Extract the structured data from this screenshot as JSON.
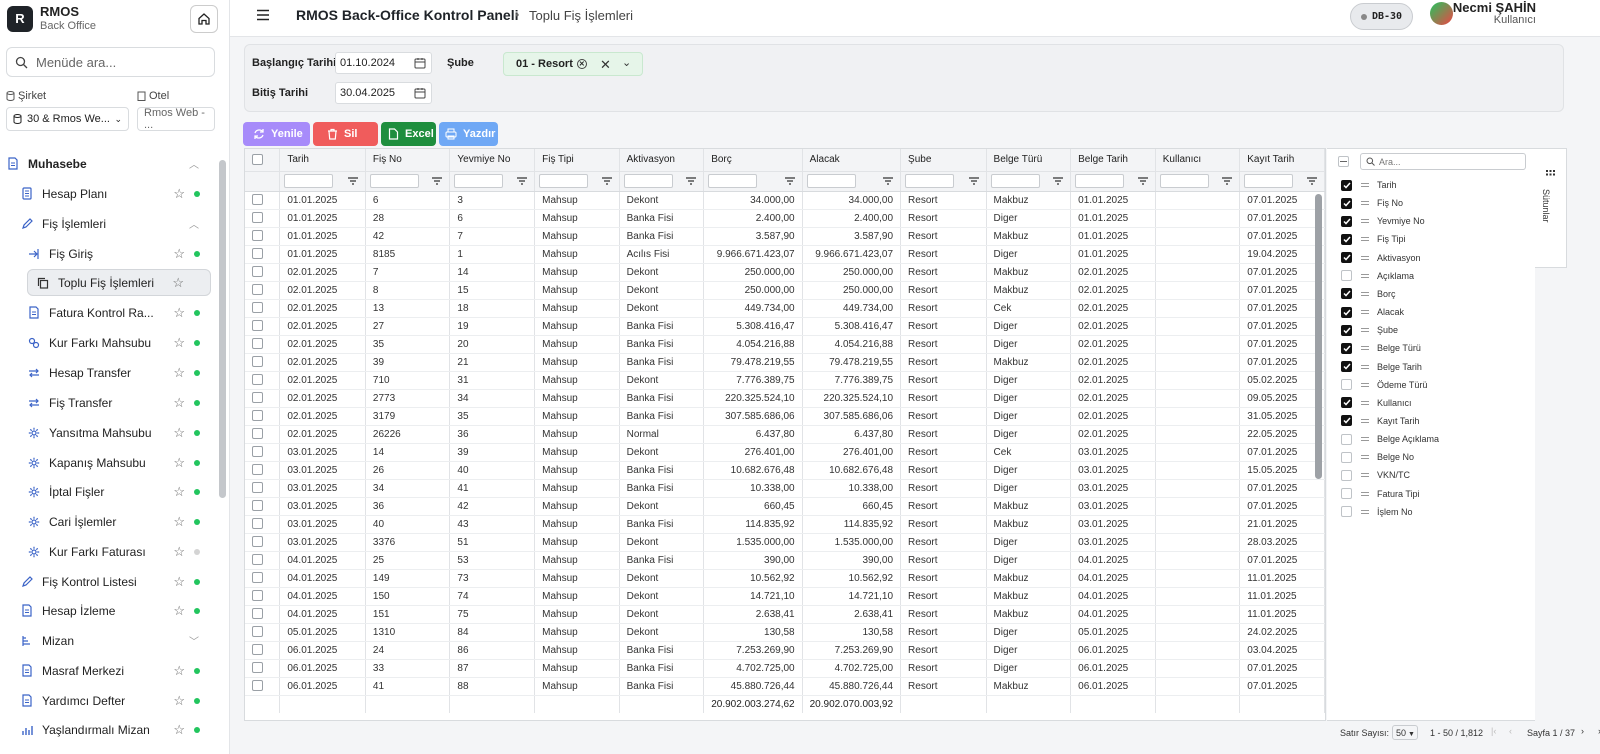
{
  "brand": {
    "name": "RMOS",
    "subtitle": "Back Office",
    "logo_letter": "R"
  },
  "menu_search": {
    "placeholder": "Menüde ara..."
  },
  "company": {
    "label": "Şirket",
    "value": "30 & Rmos We..."
  },
  "hotel": {
    "label": "Otel",
    "value": "Rmos Web - ..."
  },
  "nav": [
    {
      "label": "Muhasebe",
      "icon": "document-icon",
      "trail": "chevron-up"
    },
    {
      "label": "Hesap Planı",
      "icon": "ledger-icon",
      "trail": "star-dot"
    },
    {
      "label": "Fiş İşlemleri",
      "icon": "pencil-icon",
      "trail": "chevron-up"
    },
    {
      "label": "Fiş Giriş",
      "icon": "entry-icon",
      "trail": "star-dot"
    },
    {
      "label": "Toplu Fiş İşlemleri",
      "icon": "copy-icon",
      "trail": "star",
      "active": true
    },
    {
      "label": "Fatura Kontrol Ra...",
      "icon": "document-icon",
      "trail": "star-dot"
    },
    {
      "label": "Kur Farkı Mahsubu",
      "icon": "link-icon",
      "trail": "star-dot"
    },
    {
      "label": "Hesap Transfer",
      "icon": "transfer-icon",
      "trail": "star-dot"
    },
    {
      "label": "Fiş Transfer",
      "icon": "transfer-icon",
      "trail": "star-dot"
    },
    {
      "label": "Yansıtma Mahsubu",
      "icon": "gear-icon",
      "trail": "star-dot"
    },
    {
      "label": "Kapanış Mahsubu",
      "icon": "gear-icon",
      "trail": "star-dot"
    },
    {
      "label": "İptal Fişler",
      "icon": "gear-icon",
      "trail": "star-dot"
    },
    {
      "label": "Cari İşlemler",
      "icon": "gear-icon",
      "trail": "star-dot"
    },
    {
      "label": "Kur Farkı Faturası",
      "icon": "gear-icon",
      "trail": "star-dot-gray"
    },
    {
      "label": "Fiş Kontrol Listesi",
      "icon": "pencil-icon",
      "trail": "star-dot"
    },
    {
      "label": "Hesap İzleme",
      "icon": "document-icon",
      "trail": "star-dot"
    },
    {
      "label": "Mizan",
      "icon": "tree-icon",
      "trail": "chevron-down"
    },
    {
      "label": "Masraf Merkezi",
      "icon": "document-icon",
      "trail": "star-dot"
    },
    {
      "label": "Yardımcı Defter",
      "icon": "document-icon",
      "trail": "star-dot"
    },
    {
      "label": "Yaşlandırmalı Mizan",
      "icon": "bar-chart-icon",
      "trail": "star-dot"
    }
  ],
  "header": {
    "title": "RMOS Back-Office Kontrol Paneli",
    "breadcrumb": "Toplu Fiş İşlemleri",
    "db": "DB-30",
    "user_name": "Necmi ŞAHİN",
    "user_role": "Kullanıcı"
  },
  "filters": {
    "start_label": "Başlangıç Tarihi",
    "start_value": "01.10.2024",
    "end_label": "Bitiş Tarihi",
    "end_value": "30.04.2025",
    "branch_label": "Şube",
    "branch_chip": "01 - Resort"
  },
  "toolbar": {
    "refresh": "Yenile",
    "delete": "Sil",
    "excel": "Excel",
    "print": "Yazdır"
  },
  "colors": {
    "refresh": "#a78bfa",
    "delete": "#f05c5c",
    "excel": "#1e8e3e",
    "print": "#6fa8f5"
  },
  "grid": {
    "columns": [
      "Tarih",
      "Fiş No",
      "Yevmiye No",
      "Fiş Tipi",
      "Aktivasyon",
      "Borç",
      "Alacak",
      "Şube",
      "Belge Türü",
      "Belge Tarih",
      "Kullanıcı",
      "Kayıt Tarih"
    ],
    "rows": [
      [
        "01.01.2025",
        "6",
        "3",
        "Mahsup",
        "Dekont",
        "34.000,00",
        "34.000,00",
        "Resort",
        "Makbuz",
        "01.01.2025",
        "",
        "07.01.2025"
      ],
      [
        "01.01.2025",
        "28",
        "6",
        "Mahsup",
        "Banka Fisi",
        "2.400,00",
        "2.400,00",
        "Resort",
        "Diger",
        "01.01.2025",
        "",
        "07.01.2025"
      ],
      [
        "01.01.2025",
        "42",
        "7",
        "Mahsup",
        "Banka Fisi",
        "3.587,90",
        "3.587,90",
        "Resort",
        "Makbuz",
        "01.01.2025",
        "",
        "07.01.2025"
      ],
      [
        "01.01.2025",
        "8185",
        "1",
        "Mahsup",
        "Acılıs Fisi",
        "9.966.671.423,07",
        "9.966.671.423,07",
        "Resort",
        "Diger",
        "01.01.2025",
        "",
        "19.04.2025"
      ],
      [
        "02.01.2025",
        "7",
        "14",
        "Mahsup",
        "Dekont",
        "250.000,00",
        "250.000,00",
        "Resort",
        "Makbuz",
        "02.01.2025",
        "",
        "07.01.2025"
      ],
      [
        "02.01.2025",
        "8",
        "15",
        "Mahsup",
        "Dekont",
        "250.000,00",
        "250.000,00",
        "Resort",
        "Makbuz",
        "02.01.2025",
        "",
        "07.01.2025"
      ],
      [
        "02.01.2025",
        "13",
        "18",
        "Mahsup",
        "Dekont",
        "449.734,00",
        "449.734,00",
        "Resort",
        "Cek",
        "02.01.2025",
        "",
        "07.01.2025"
      ],
      [
        "02.01.2025",
        "27",
        "19",
        "Mahsup",
        "Banka Fisi",
        "5.308.416,47",
        "5.308.416,47",
        "Resort",
        "Diger",
        "02.01.2025",
        "",
        "07.01.2025"
      ],
      [
        "02.01.2025",
        "35",
        "20",
        "Mahsup",
        "Banka Fisi",
        "4.054.216,88",
        "4.054.216,88",
        "Resort",
        "Diger",
        "02.01.2025",
        "",
        "07.01.2025"
      ],
      [
        "02.01.2025",
        "39",
        "21",
        "Mahsup",
        "Banka Fisi",
        "79.478.219,55",
        "79.478.219,55",
        "Resort",
        "Makbuz",
        "02.01.2025",
        "",
        "07.01.2025"
      ],
      [
        "02.01.2025",
        "710",
        "31",
        "Mahsup",
        "Dekont",
        "7.776.389,75",
        "7.776.389,75",
        "Resort",
        "Diger",
        "02.01.2025",
        "",
        "05.02.2025"
      ],
      [
        "02.01.2025",
        "2773",
        "34",
        "Mahsup",
        "Banka Fisi",
        "220.325.524,10",
        "220.325.524,10",
        "Resort",
        "Diger",
        "02.01.2025",
        "",
        "09.05.2025"
      ],
      [
        "02.01.2025",
        "3179",
        "35",
        "Mahsup",
        "Banka Fisi",
        "307.585.686,06",
        "307.585.686,06",
        "Resort",
        "Diger",
        "02.01.2025",
        "",
        "31.05.2025"
      ],
      [
        "02.01.2025",
        "26226",
        "36",
        "Mahsup",
        "Normal",
        "6.437,80",
        "6.437,80",
        "Resort",
        "Diger",
        "02.01.2025",
        "",
        "22.05.2025"
      ],
      [
        "03.01.2025",
        "14",
        "39",
        "Mahsup",
        "Dekont",
        "276.401,00",
        "276.401,00",
        "Resort",
        "Cek",
        "03.01.2025",
        "",
        "07.01.2025"
      ],
      [
        "03.01.2025",
        "26",
        "40",
        "Mahsup",
        "Banka Fisi",
        "10.682.676,48",
        "10.682.676,48",
        "Resort",
        "Diger",
        "03.01.2025",
        "",
        "15.05.2025"
      ],
      [
        "03.01.2025",
        "34",
        "41",
        "Mahsup",
        "Banka Fisi",
        "10.338,00",
        "10.338,00",
        "Resort",
        "Diger",
        "03.01.2025",
        "",
        "07.01.2025"
      ],
      [
        "03.01.2025",
        "36",
        "42",
        "Mahsup",
        "Dekont",
        "660,45",
        "660,45",
        "Resort",
        "Makbuz",
        "03.01.2025",
        "",
        "07.01.2025"
      ],
      [
        "03.01.2025",
        "40",
        "43",
        "Mahsup",
        "Banka Fisi",
        "114.835,92",
        "114.835,92",
        "Resort",
        "Makbuz",
        "03.01.2025",
        "",
        "21.01.2025"
      ],
      [
        "03.01.2025",
        "3376",
        "51",
        "Mahsup",
        "Dekont",
        "1.535.000,00",
        "1.535.000,00",
        "Resort",
        "Diger",
        "03.01.2025",
        "",
        "28.03.2025"
      ],
      [
        "04.01.2025",
        "25",
        "53",
        "Mahsup",
        "Banka Fisi",
        "390,00",
        "390,00",
        "Resort",
        "Diger",
        "04.01.2025",
        "",
        "07.01.2025"
      ],
      [
        "04.01.2025",
        "149",
        "73",
        "Mahsup",
        "Dekont",
        "10.562,92",
        "10.562,92",
        "Resort",
        "Makbuz",
        "04.01.2025",
        "",
        "11.01.2025"
      ],
      [
        "04.01.2025",
        "150",
        "74",
        "Mahsup",
        "Dekont",
        "14.721,10",
        "14.721,10",
        "Resort",
        "Makbuz",
        "04.01.2025",
        "",
        "11.01.2025"
      ],
      [
        "04.01.2025",
        "151",
        "75",
        "Mahsup",
        "Dekont",
        "2.638,41",
        "2.638,41",
        "Resort",
        "Makbuz",
        "04.01.2025",
        "",
        "11.01.2025"
      ],
      [
        "05.01.2025",
        "1310",
        "84",
        "Mahsup",
        "Dekont",
        "130,58",
        "130,58",
        "Resort",
        "Diger",
        "05.01.2025",
        "",
        "24.02.2025"
      ],
      [
        "06.01.2025",
        "24",
        "86",
        "Mahsup",
        "Banka Fisi",
        "7.253.269,90",
        "7.253.269,90",
        "Resort",
        "Diger",
        "06.01.2025",
        "",
        "03.04.2025"
      ],
      [
        "06.01.2025",
        "33",
        "87",
        "Mahsup",
        "Banka Fisi",
        "4.702.725,00",
        "4.702.725,00",
        "Resort",
        "Diger",
        "06.01.2025",
        "",
        "07.01.2025"
      ],
      [
        "06.01.2025",
        "41",
        "88",
        "Mahsup",
        "Banka Fisi",
        "45.880.726,44",
        "45.880.726,44",
        "Resort",
        "Makbuz",
        "06.01.2025",
        "",
        "07.01.2025"
      ]
    ],
    "total_borc": "20.902.003.274,62",
    "total_alacak": "20.902.070.003,92"
  },
  "column_panel": {
    "search_placeholder": "Ara...",
    "tab_label": "Sütunlar",
    "items": [
      {
        "label": "Tarih",
        "checked": true
      },
      {
        "label": "Fiş No",
        "checked": true
      },
      {
        "label": "Yevmiye No",
        "checked": true
      },
      {
        "label": "Fiş Tipi",
        "checked": true
      },
      {
        "label": "Aktivasyon",
        "checked": true
      },
      {
        "label": "Açıklama",
        "checked": false
      },
      {
        "label": "Borç",
        "checked": true
      },
      {
        "label": "Alacak",
        "checked": true
      },
      {
        "label": "Şube",
        "checked": true
      },
      {
        "label": "Belge Türü",
        "checked": true
      },
      {
        "label": "Belge Tarih",
        "checked": true
      },
      {
        "label": "Ödeme Türü",
        "checked": false
      },
      {
        "label": "Kullanıcı",
        "checked": true
      },
      {
        "label": "Kayıt Tarih",
        "checked": true
      },
      {
        "label": "Belge Açıklama",
        "checked": false
      },
      {
        "label": "Belge No",
        "checked": false
      },
      {
        "label": "VKN/TC",
        "checked": false
      },
      {
        "label": "Fatura Tipi",
        "checked": false
      },
      {
        "label": "İşlem No",
        "checked": false
      }
    ]
  },
  "pager": {
    "rows_label": "Satır Sayısı:",
    "rows_value": "50",
    "range": "1 - 50 / 1,812",
    "page": "Sayfa 1 / 37"
  }
}
